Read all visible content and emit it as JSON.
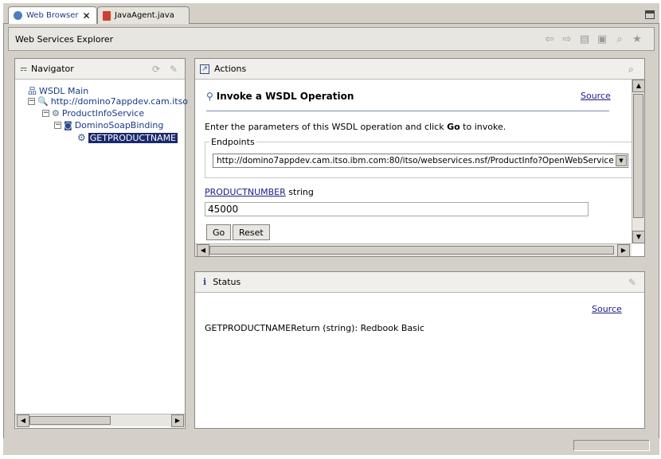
{
  "tabs": [
    {
      "label": "Web Browser"
    },
    {
      "label": "JavaAgent.java"
    }
  ],
  "header": {
    "title": "Web Services Explorer"
  },
  "navigator": {
    "title": "Navigator",
    "tree": [
      {
        "label": "WSDL Main"
      },
      {
        "label": "http://domino7appdev.cam.itso"
      },
      {
        "label": "ProductInfoService"
      },
      {
        "label": "DominoSoapBinding"
      },
      {
        "label": "GETPRODUCTNAME"
      }
    ]
  },
  "actions": {
    "title": "Actions",
    "heading": "Invoke a WSDL Operation",
    "source_link": "Source",
    "instructions_pre": "Enter the parameters of this WSDL operation and click ",
    "instructions_bold": "Go",
    "instructions_post": " to invoke.",
    "endpoints_label": "Endpoints",
    "endpoint_value": "http://domino7appdev.cam.itso.ibm.com:80/itso/webservices.nsf/ProductInfo?OpenWebService",
    "param_name": "PRODUCTNUMBER",
    "param_type": "string",
    "param_value": "45000",
    "go_label": "Go",
    "reset_label": "Reset"
  },
  "status": {
    "title": "Status",
    "source_link": "Source",
    "result": "GETPRODUCTNAMEReturn (string):  Redbook Basic"
  }
}
